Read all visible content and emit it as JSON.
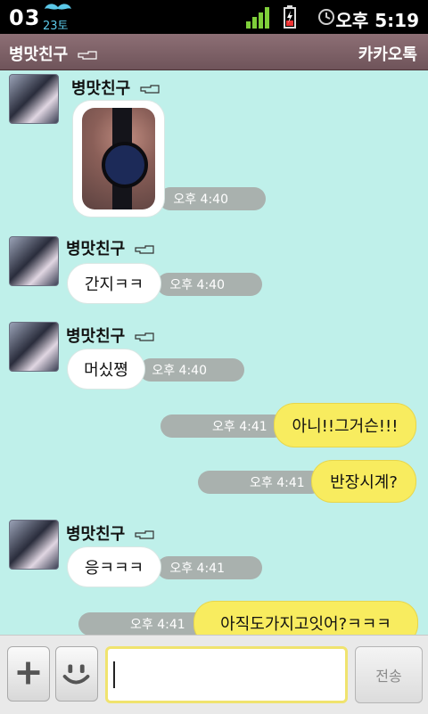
{
  "status_bar": {
    "date": "03",
    "day": "23토",
    "time": "오후 5:19"
  },
  "title_bar": {
    "title": "병맛친구",
    "app_name": "카카오톡"
  },
  "messages": [
    {
      "sender": "병맛친구",
      "type": "photo",
      "time": "오후 4:40"
    },
    {
      "sender": "병맛친구",
      "type": "text",
      "text": "간지ㅋㅋ",
      "time": "오후 4:40"
    },
    {
      "sender": "병맛친구",
      "type": "text",
      "text": "머싰쪙",
      "time": "오후 4:40"
    },
    {
      "sender": "me",
      "type": "text",
      "text": "아니!!그거슨!!!",
      "time": "오후 4:41"
    },
    {
      "sender": "me",
      "type": "text",
      "text": "반장시계?",
      "time": "오후 4:41"
    },
    {
      "sender": "병맛친구",
      "type": "text",
      "text": "응ㅋㅋㅋ",
      "time": "오후 4:41"
    },
    {
      "sender": "me",
      "type": "text",
      "text": "아직도가지고잇어?ㅋㅋㅋ",
      "time": "오후 4:41"
    }
  ],
  "input_bar": {
    "message_value": "",
    "send_label": "전송"
  },
  "icons": {
    "plus": "plus-icon",
    "emoticon": "smiley-icon",
    "hand": "pointing-hand-icon"
  },
  "colors": {
    "chat_background": "#bff0ea",
    "my_bubble": "#f8ec5f",
    "other_bubble": "#ffffff",
    "title_bar": "#7a5f65"
  }
}
